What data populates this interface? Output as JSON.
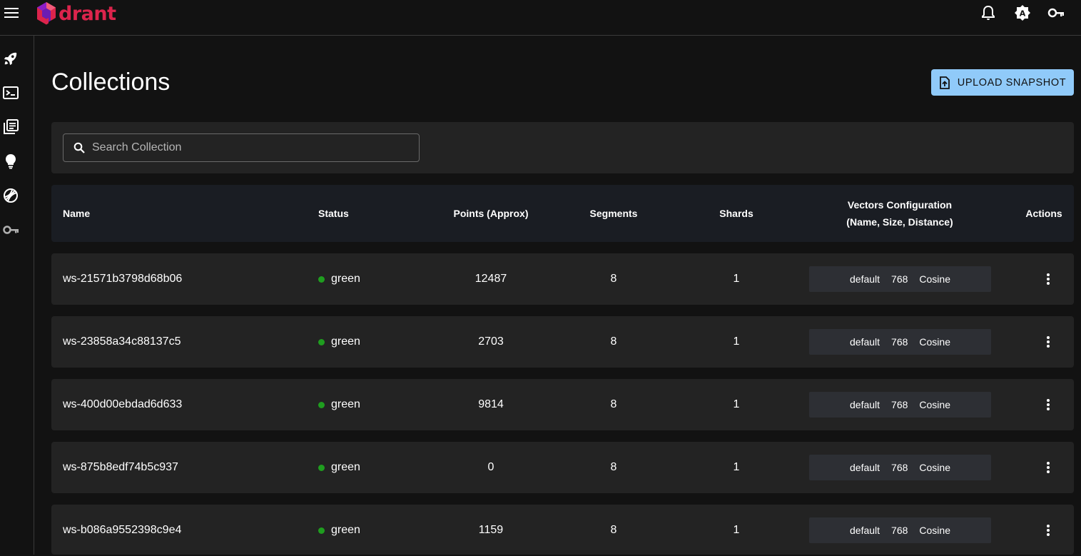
{
  "app": {
    "logo_text": "drant",
    "brand_color": "#dc244c",
    "accent_color": "#90caf9"
  },
  "topbar": {
    "icons": [
      "menu-icon",
      "bell-icon",
      "theme-icon",
      "key-icon"
    ]
  },
  "sidebar": {
    "icons": [
      "rocket-icon",
      "console-icon",
      "collections-icon",
      "lightbulb-icon",
      "datasets-icon",
      "key-icon"
    ]
  },
  "page": {
    "title": "Collections",
    "upload_label": "UPLOAD SNAPSHOT"
  },
  "search": {
    "placeholder": "Search Collection",
    "value": ""
  },
  "table": {
    "headers": {
      "name": "Name",
      "status": "Status",
      "points": "Points (Approx)",
      "segments": "Segments",
      "shards": "Shards",
      "vectors_line1": "Vectors Configuration",
      "vectors_line2": "(Name, Size, Distance)",
      "actions": "Actions"
    },
    "rows": [
      {
        "name": "ws-21571b3798d68b06",
        "status": "green",
        "points": "12487",
        "segments": "8",
        "shards": "1",
        "vec_name": "default",
        "vec_size": "768",
        "vec_distance": "Cosine"
      },
      {
        "name": "ws-23858a34c88137c5",
        "status": "green",
        "points": "2703",
        "segments": "8",
        "shards": "1",
        "vec_name": "default",
        "vec_size": "768",
        "vec_distance": "Cosine"
      },
      {
        "name": "ws-400d00ebdad6d633",
        "status": "green",
        "points": "9814",
        "segments": "8",
        "shards": "1",
        "vec_name": "default",
        "vec_size": "768",
        "vec_distance": "Cosine"
      },
      {
        "name": "ws-875b8edf74b5c937",
        "status": "green",
        "points": "0",
        "segments": "8",
        "shards": "1",
        "vec_name": "default",
        "vec_size": "768",
        "vec_distance": "Cosine"
      },
      {
        "name": "ws-b086a9552398c9e4",
        "status": "green",
        "points": "1159",
        "segments": "8",
        "shards": "1",
        "vec_name": "default",
        "vec_size": "768",
        "vec_distance": "Cosine"
      }
    ]
  }
}
